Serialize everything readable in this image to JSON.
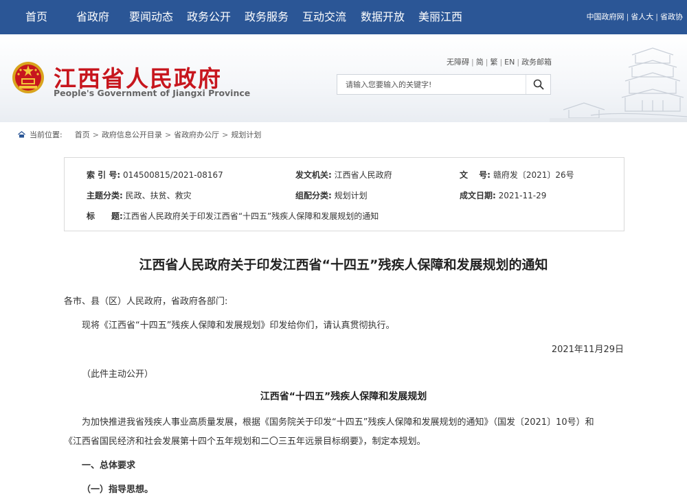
{
  "topnav": {
    "items": [
      "首页",
      "省政府",
      "要闻动态",
      "政务公开",
      "政务服务",
      "互动交流",
      "数据开放",
      "美丽江西"
    ],
    "links": [
      "中国政府网",
      "省人大",
      "省政协"
    ]
  },
  "header": {
    "title": "江西省人民政府",
    "subtitle": "People's Government of Jiangxi Province",
    "util_links": [
      "无障碍",
      "简",
      "繁",
      "EN",
      "政务邮箱"
    ],
    "search_placeholder": "请输入您要输入的关键字!"
  },
  "breadcrumb": {
    "label": "当前位置:",
    "items": [
      "首页",
      "政府信息公开目录",
      "省政府办公厅",
      "规划计划"
    ]
  },
  "meta": {
    "index_label": "索 引 号:",
    "index_value": "014500815/2021-08167",
    "issuer_label": "发文机关:",
    "issuer_value": "江西省人民政府",
    "docno_label": "文　 号:",
    "docno_value": "赣府发〔2021〕26号",
    "topic_label": "主题分类:",
    "topic_value": "民政、扶贫、救灾",
    "category_label": "组配分类:",
    "category_value": "规划计划",
    "date_label": "成文日期:",
    "date_value": "2021-11-29",
    "title_label": "标　　题:",
    "title_value": "江西省人民政府关于印发江西省“十四五”残疾人保障和发展规划的通知"
  },
  "article": {
    "title": "江西省人民政府关于印发江西省“十四五”残疾人保障和发展规划的通知",
    "salutation": "各市、县（区）人民政府，省政府各部门:",
    "body1": "现将《江西省“十四五”残疾人保障和发展规划》印发给你们，请认真贯彻执行。",
    "date": "2021年11月29日",
    "public_note": "（此件主动公开）",
    "subtitle": "江西省“十四五”残疾人保障和发展规划",
    "body2_line1": "为加快推进我省残疾人事业高质量发展，根据《国务院关于印发“十四五”残疾人保障和发展规划的通知》（国发〔2021〕10号）和",
    "body2_line2": "《江西省国民经济和社会发展第十四个五年规划和二〇三五年远景目标纲要》，制定本规划。",
    "section1": "一、总体要求",
    "section1_1": "（一）指导思想。"
  }
}
